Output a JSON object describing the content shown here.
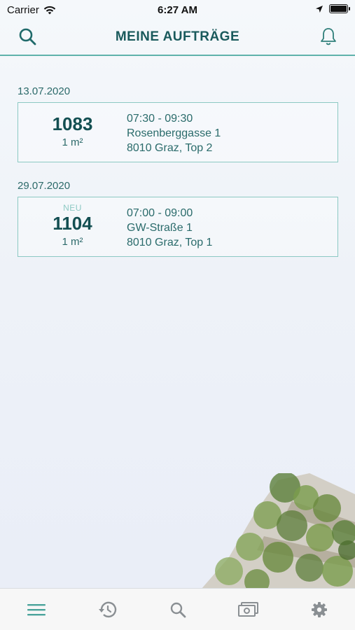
{
  "status_bar": {
    "carrier": "Carrier",
    "time": "6:27 AM"
  },
  "header": {
    "title": "MEINE AUFTRÄGE"
  },
  "orders": [
    {
      "date": "13.07.2020",
      "badge": "",
      "number": "1083",
      "area": "1 m²",
      "time": "07:30 - 09:30",
      "street": "Rosenberggasse 1",
      "city": "8010 Graz, Top 2"
    },
    {
      "date": "29.07.2020",
      "badge": "NEU",
      "number": "1104",
      "area": "1 m²",
      "time": "07:00 - 09:00",
      "street": "GW-Straße 1",
      "city": "8010 Graz, Top 1"
    }
  ],
  "colors": {
    "accent": "#5fb3ab",
    "text_dark": "#134f52",
    "border": "#8cc9c3"
  },
  "tab_bar": {
    "items": [
      "menu-icon",
      "history-icon",
      "search-icon",
      "money-icon",
      "gear-icon"
    ],
    "active": "menu-icon"
  }
}
